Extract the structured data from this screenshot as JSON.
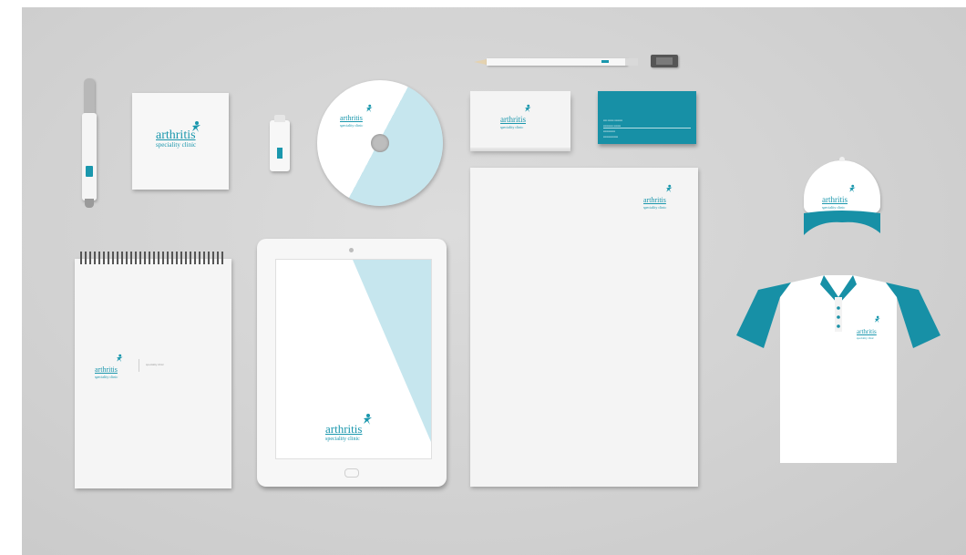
{
  "brand": {
    "name": "arthritis",
    "tagline": "speciality clinic",
    "color": "#1a97ad",
    "light_color": "#c6e6ee"
  },
  "notebook": {
    "side_text": "▬▬▬▬▬▬▬"
  },
  "business_card": {
    "lines": [
      "▪▪▪▪ ▪▪▪▪▪▪ ▪▪▪▪▪▪▪▪",
      "▪▪▪▪▪▪▪▪▪▪ ▪▪▪▪▪▪▪",
      "▪▪▪▪▪▪▪▪▪▪▪▪",
      "▪▪▪▪▪▪▪▪▪▪▪▪▪▪▪"
    ]
  }
}
